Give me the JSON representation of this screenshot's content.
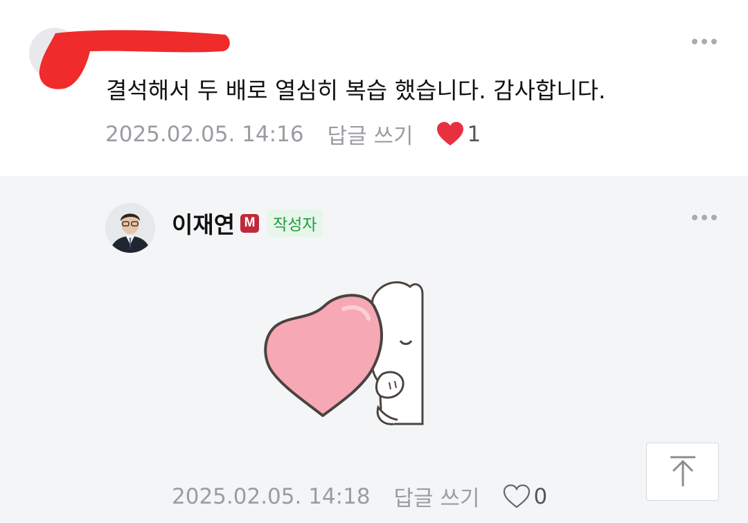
{
  "comment1": {
    "text": "결석해서 두 배로 열심히 복습 했습니다. 감사합니다.",
    "date": "2025.02.05. 14:16",
    "reply_label": "답글 쓰기",
    "like_count": "1",
    "liked": true
  },
  "comment2": {
    "author": "이재연",
    "badge_m": "M",
    "badge_writer": "작성자",
    "date": "2025.02.05. 14:18",
    "reply_label": "답글 쓰기",
    "like_count": "0",
    "liked": false
  },
  "colors": {
    "heart_red": "#e8313f",
    "badge_red": "#c0293a",
    "writer_green": "#1b9e3e",
    "reply_bg": "#f4f5f7"
  },
  "icons": [
    "more-icon",
    "heart-filled-icon",
    "heart-outline-icon",
    "scroll-top-icon"
  ]
}
